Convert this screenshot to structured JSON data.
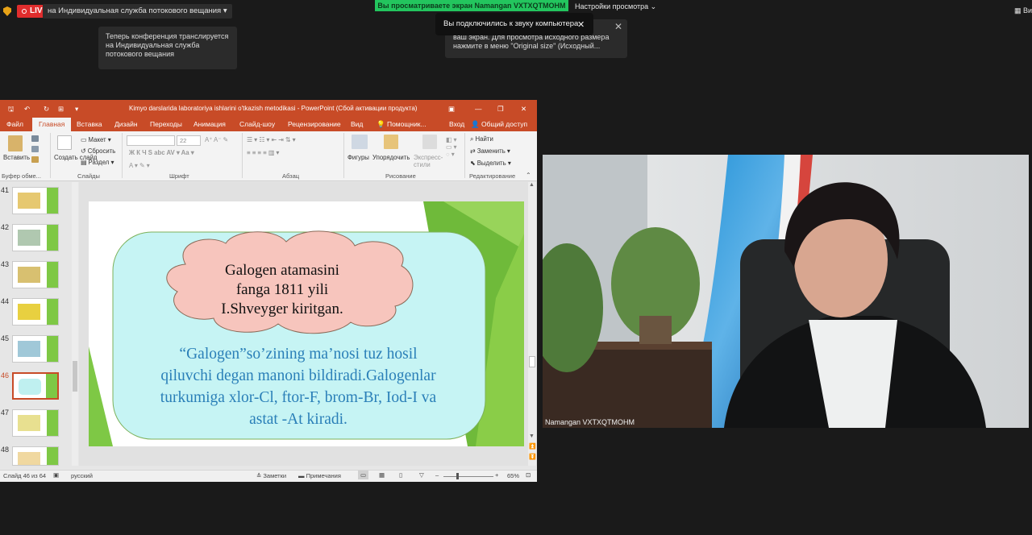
{
  "zoom_top": {
    "live_label": "LIVE",
    "stream_dropdown": "на Индивидуальная служба потокового вещания",
    "viewing_banner": "Вы  просматриваете экран Namangan VXTXQTMOHM",
    "view_options": "Настройки просмотра",
    "video_button": "Вид",
    "tooltip_streaming": "Теперь конференция транслируется на Индивидуальная служба потокового вещания",
    "tooltip_original_size": "ваш экран. Для просмотра исходного размера нажмите в меню \"Original size\" (Исходный...",
    "tooltip_audio": "Вы подключились к звуку компьютера"
  },
  "ppt": {
    "title": "Kimyo darslarida laboratoriya ishlarini o'tkazish metodikasi - PowerPoint (Сбой активации продукта)",
    "tabs": [
      "Файл",
      "Главная",
      "Вставка",
      "Дизайн",
      "Переходы",
      "Анимация",
      "Слайд-шоу",
      "Рецензирование",
      "Вид",
      "Помощник...",
      "Вход",
      "Общий доступ"
    ],
    "ribbon": {
      "paste": "Вставить",
      "new_slide": "Создать слайд",
      "layout": "Макет",
      "reset": "Сбросить",
      "section": "Раздел",
      "font_size": "22",
      "shapes": "Фигуры",
      "arrange": "Упорядочить",
      "quick_styles": "Экспресс-стили",
      "find": "Найти",
      "replace": "Заменить",
      "select": "Выделить",
      "groups": [
        "Буфер обме...",
        "Слайды",
        "Шрифт",
        "Абзац",
        "Рисование",
        "Редактирование"
      ]
    },
    "thumb_numbers": [
      "41",
      "42",
      "43",
      "44",
      "45",
      "46",
      "47",
      "48"
    ],
    "selected_slide": 46,
    "slide": {
      "cloud_lines": [
        "Galogen atamasini",
        "fanga 1811 yili",
        "I.Shveyger kiritgan."
      ],
      "main_lines": [
        "“Galogen”so’zining ma’nosi tuz hosil",
        "qiluvchi degan manoni bildiradi.Galogenlar",
        "turkumiga xlor-Cl, ftor-F, brom-Br, Iod-I va",
        "astat -At kiradi."
      ]
    },
    "status": {
      "slide_count": "Слайд 46 из 64",
      "language": "русский",
      "notes": "Заметки",
      "comments": "Примечания",
      "zoom": "65%"
    }
  },
  "video": {
    "participant_name": "Namangan VXTXQTMOHM"
  }
}
